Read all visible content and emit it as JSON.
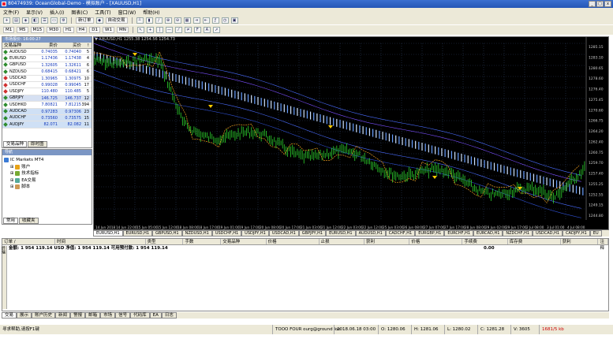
{
  "app": {
    "title": "80474939: OceanGlobal-Demo - 模拟账户 - [XAUUSD,H1]",
    "min": "_",
    "max": "□",
    "close": "x"
  },
  "menu": [
    "文件(F)",
    "显示(V)",
    "插入(I)",
    "图表(C)",
    "工具(T)",
    "窗口(W)",
    "帮助(H)"
  ],
  "toolbar1": {
    "new_order": "新订单",
    "autotrade": "自动交易"
  },
  "toolbar2": [
    "M1",
    "M5",
    "M15",
    "M30",
    "H1",
    "H4",
    "D1",
    "W1",
    "MN"
  ],
  "market_watch": {
    "title": "市场报价: 16:00:27",
    "headers": [
      "交易品种",
      "卖价",
      "买价",
      "!"
    ],
    "rows": [
      {
        "symbol": "AUDUSD",
        "bid": "0.74035",
        "ask": "0.74040",
        "spread": "5",
        "color": "#2e8b2e"
      },
      {
        "symbol": "EURUSD",
        "bid": "1.17436",
        "ask": "1.17438",
        "spread": "4",
        "color": "#2e8b2e"
      },
      {
        "symbol": "GBPUSD",
        "bid": "1.32605",
        "ask": "1.32611",
        "spread": "6",
        "color": "#2e8b2e"
      },
      {
        "symbol": "NZDUSD",
        "bid": "0.68415",
        "ask": "0.68421",
        "spread": "6",
        "color": "#2e8b2e"
      },
      {
        "symbol": "USDCAD",
        "bid": "1.30965",
        "ask": "1.30975",
        "spread": "10",
        "color": "#d03030"
      },
      {
        "symbol": "USDCHF",
        "bid": "0.99028",
        "ask": "0.99045",
        "spread": "17",
        "color": "#d03030"
      },
      {
        "symbol": "USDJPY",
        "bid": "110.480",
        "ask": "110.485",
        "spread": "5",
        "color": "#d03030"
      },
      {
        "symbol": "GBPJPY",
        "bid": "146.725",
        "ask": "146.737",
        "spread": "12",
        "color": "#2e8b2e"
      },
      {
        "symbol": "USDHKD",
        "bid": "7.80821",
        "ask": "7.81215",
        "spread": "394",
        "color": "#2e8b2e"
      },
      {
        "symbol": "AUDCAD",
        "bid": "0.97283",
        "ask": "0.97306",
        "spread": "23",
        "color": "#2e8b2e"
      },
      {
        "symbol": "AUDCHF",
        "bid": "0.73560",
        "ask": "0.73575",
        "spread": "15",
        "color": "#2e8b2e"
      },
      {
        "symbol": "AUDJPY",
        "bid": "82.071",
        "ask": "82.082",
        "spread": "11",
        "color": "#2e8b2e"
      }
    ],
    "tabs": [
      "交易品种",
      "即时图"
    ]
  },
  "navigator": {
    "title": "导航",
    "items": [
      {
        "label": "IC Markets MT4",
        "indent": 0,
        "color": "#3a7bd5"
      },
      {
        "label": "账户",
        "indent": 1,
        "color": "#e8a317"
      },
      {
        "label": "技术指标",
        "indent": 1,
        "color": "#7a3"
      },
      {
        "label": "EA交易",
        "indent": 1,
        "color": "#5a9"
      },
      {
        "label": "脚本",
        "indent": 1,
        "color": "#c95"
      }
    ],
    "tabs": [
      "常用",
      "收藏夹"
    ]
  },
  "chart": {
    "header": "▼ XAUUSD,H1  1255.38 1254.56 1254.73",
    "price_labels": [
      "1285.15",
      "1283.10",
      "1280.65",
      "1278.60",
      "1276.40",
      "1275.45",
      "1270.60",
      "1266.75",
      "1264.20",
      "1262.40",
      "1260.75",
      "1259.70",
      "1257.40",
      "1255.25",
      "1252.55",
      "1249.15",
      "1244.80"
    ],
    "time_labels": [
      "14 Jun 2018",
      "14 Jun 22:00",
      "15 Jun 05:00",
      "15 Jun 12:00",
      "18 Jun 08:00",
      "18 Jun 17:00",
      "19 Jun 01:00",
      "19 Jun 17:00",
      "20 Jun 08:00",
      "20 Jun 17:00",
      "21 Jun 03:00",
      "21 Jun 12:00",
      "22 Jun 03:00",
      "22 Jun 12:00",
      "25 Jun 03:00",
      "26 Jun 08:00",
      "27 Jun 07:00",
      "27 Jun 17:00",
      "28 Jun 08:00",
      "29 Jun 02:00",
      "29 Jun 17:00",
      "2 Jul 08:00",
      "3 Jul 01:00",
      "4 Jul 08:00"
    ]
  },
  "symbol_tabs": [
    "EURUSD,H1",
    "EURUSD,H1",
    "GBPUSD,H1",
    "NZDUSD,H1",
    "USDCHF,H1",
    "USDJPY,H1",
    "USDCAD,H1",
    "GBPJPY,H1",
    "EURUSD,H1",
    "AUDUSD,H1",
    "CADCHF,H1",
    "EURGBP,H1",
    "EURCHF,H1",
    "EURCAD,H1",
    "NZDCHF,H1",
    "USDCAD,H1",
    "CADJPY,H1",
    "EU"
  ],
  "terminal": {
    "headers": [
      "订单 /",
      "时间",
      "类型",
      "手数",
      "交易品种",
      "价格",
      "止损",
      "获利",
      "价格",
      "手续费",
      "库存费",
      "获利"
    ],
    "balance": "金额: 1 954 119.14 USD  净值: 1 954 119.14  可用预付款: 1 954 119.14",
    "profit": "0.00",
    "notes": "注释",
    "tabs": [
      "交易",
      "展示",
      "账户历史",
      "新闻",
      "警报",
      "邮箱",
      "市场",
      "信号",
      "代码库",
      "EA",
      "日志"
    ],
    "side_label": "终端"
  },
  "status": {
    "help": "寻求帮助,请按F1键",
    "profile": "TOOO FOUR ourg@ground loe",
    "datetime": "2018.06.18 03:00",
    "open": "O: 1280.06",
    "high": "H: 1281.06",
    "low": "L: 1280.02",
    "close": "C: 1281.28",
    "volume": "V: 3605",
    "traffic": "1681/5 kb"
  }
}
